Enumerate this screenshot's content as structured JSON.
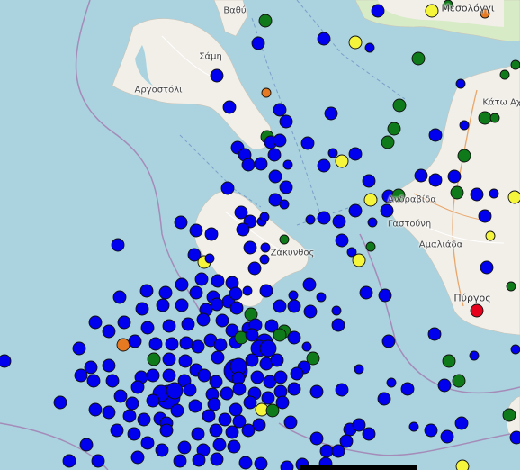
{
  "map": {
    "colors": {
      "sea": "#aad3df",
      "land": "#f2efe9",
      "land_green": "#d7ebc6",
      "border": "#a58bb8",
      "ferry": "#7b9fc9",
      "road_major": "#e8a66a",
      "road_minor": "#ffffff",
      "quake_blue": "#0000ee",
      "quake_green": "#0f7a1a",
      "quake_yellow": "#f5f53c",
      "quake_orange": "#e57a22",
      "quake_red": "#e6001c"
    },
    "labels": [
      {
        "name": "label-vathy",
        "text": "Βαθύ"
      },
      {
        "name": "label-sami",
        "text": "Σάμη"
      },
      {
        "name": "label-argostoli",
        "text": "Αργοστόλι"
      },
      {
        "name": "label-mesolongi",
        "text": "Μεσολόγγι"
      },
      {
        "name": "label-kato-achaia",
        "text": "Κάτω Αχ"
      },
      {
        "name": "label-andravida",
        "text": "Ανδραβίδα"
      },
      {
        "name": "label-gastouni",
        "text": "Γαστούνη"
      },
      {
        "name": "label-amaliada",
        "text": "Αμαλιάδα"
      },
      {
        "name": "label-zakynthos",
        "text": "Ζάκυνθος"
      },
      {
        "name": "label-pyrgos",
        "text": "Πύργος"
      }
    ]
  }
}
